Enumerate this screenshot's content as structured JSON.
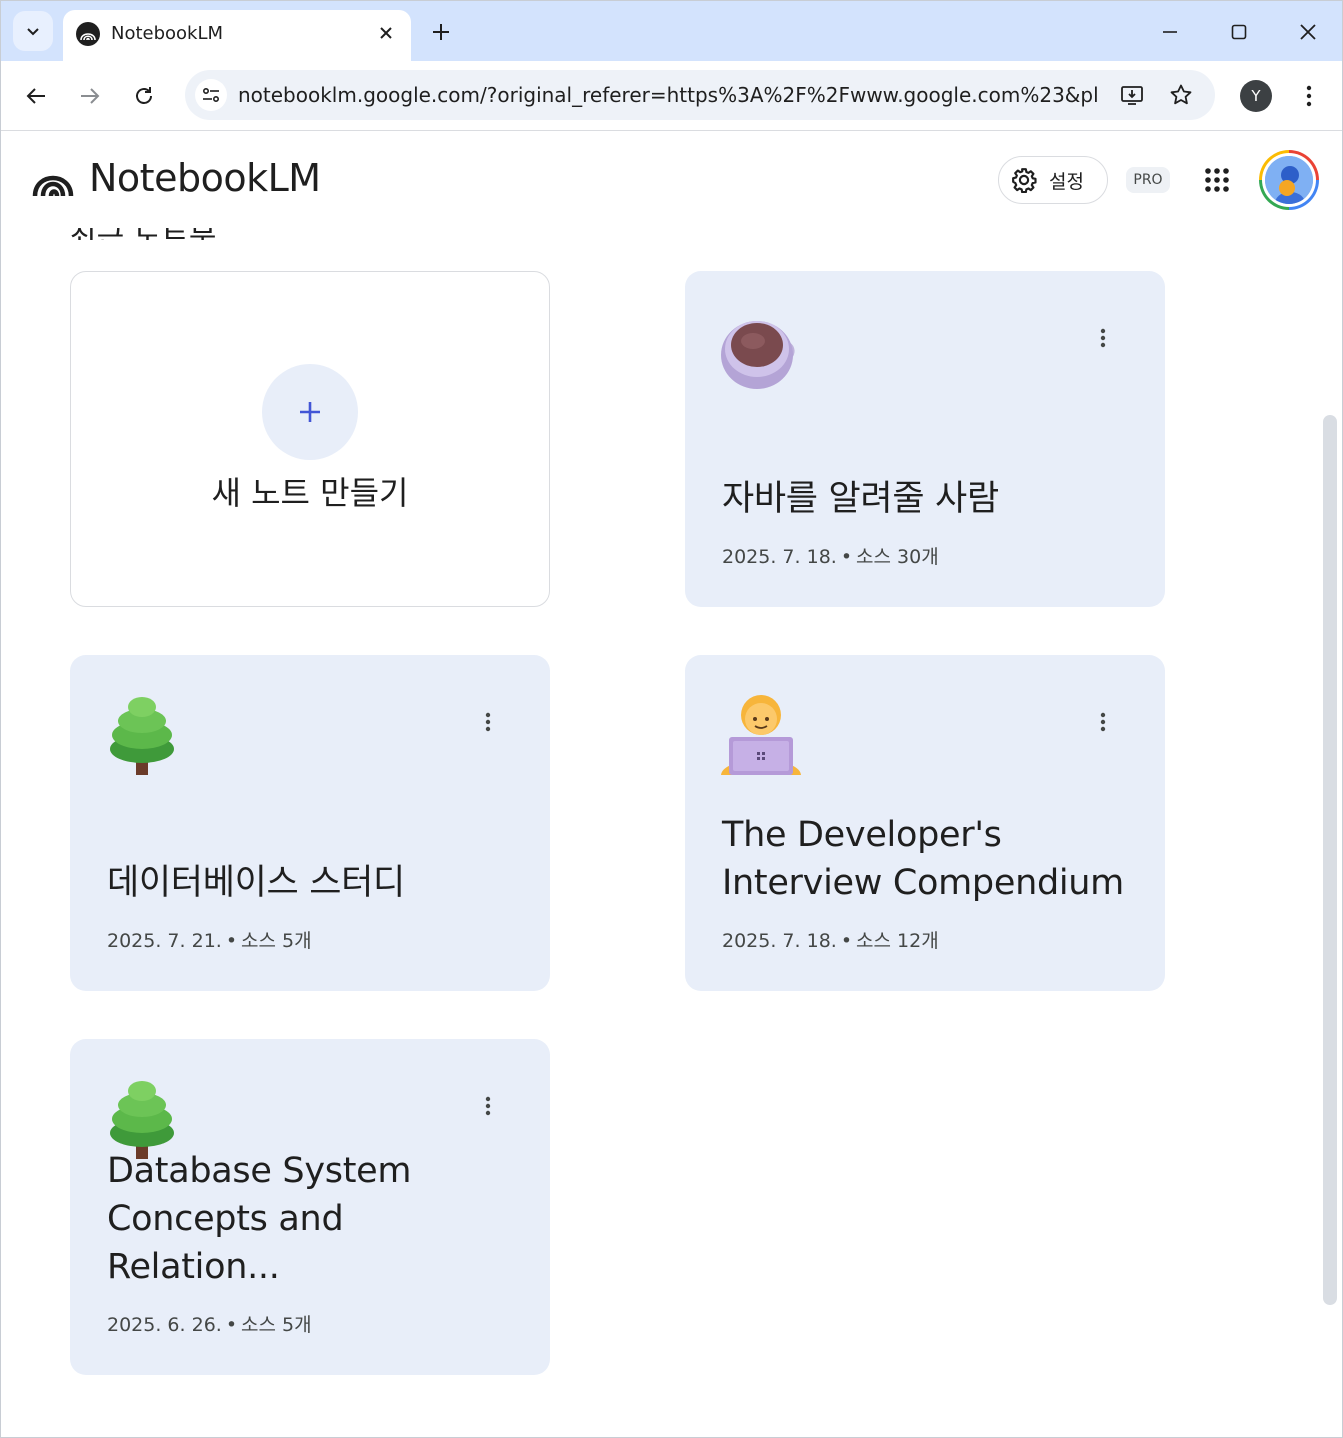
{
  "browser": {
    "tab_title": "NotebookLM",
    "url": "notebooklm.google.com/?original_referer=https%3A%2F%2Fwww.google.com%23&pli=...",
    "profile_initial": "Y"
  },
  "app": {
    "name": "NotebookLM",
    "settings_label": "설정",
    "pro_badge": "PRO",
    "section_heading_partial": "최근 노트북"
  },
  "new_notebook": {
    "label": "새 노트 만들기",
    "icon": "plus-icon"
  },
  "notebooks": [
    {
      "emoji": "coffee-cup",
      "title": "자바를 알려줄 사람",
      "date": "2025. 7. 18.",
      "sources": "소스 30개"
    },
    {
      "emoji": "tree",
      "title": "데이터베이스 스터디",
      "date": "2025. 7. 21.",
      "sources": "소스 5개"
    },
    {
      "emoji": "technologist",
      "title": "The Developer's Interview Compendium",
      "date": "2025. 7. 18.",
      "sources": "소스 12개"
    },
    {
      "emoji": "tree",
      "title": "Database System Concepts and Relation...",
      "date": "2025. 6. 26.",
      "sources": "소스 5개"
    }
  ],
  "colors": {
    "card_bg": "#e8eef9",
    "accent": "#4255d6",
    "tabstrip": "#d3e3fd"
  }
}
